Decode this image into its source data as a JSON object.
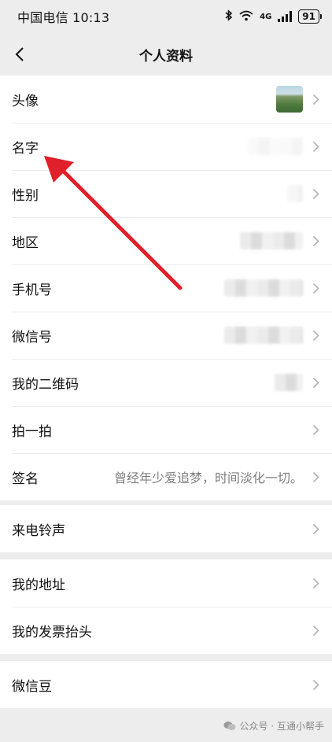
{
  "status_bar": {
    "carrier_time": "中国电信 10:13",
    "network": "4G",
    "battery": "91",
    "icons": [
      "bluetooth-icon",
      "wifi-icon",
      "signal-icon",
      "battery-icon"
    ]
  },
  "nav": {
    "back_icon": "chevron-left-icon",
    "title": "个人资料"
  },
  "profile": {
    "avatar_label": "头像",
    "name_label": "名字",
    "gender_label": "性别",
    "region_label": "地区",
    "phone_label": "手机号",
    "wechat_id_label": "微信号",
    "qrcode_label": "我的二维码",
    "pat_label": "拍一拍",
    "signature_label": "签名",
    "signature_value": "曾经年少爱追梦，时间淡化一切。"
  },
  "ringtone": {
    "label": "来电铃声"
  },
  "address": {
    "address_label": "我的地址",
    "invoice_label": "我的发票抬头"
  },
  "beans": {
    "label": "微信豆"
  },
  "watermark": {
    "text": "公众号 · 互通小帮手"
  },
  "colors": {
    "background": "#ededed",
    "card": "#ffffff",
    "annotation_arrow": "#e0202a",
    "secondary_text": "#7f7f7f"
  }
}
